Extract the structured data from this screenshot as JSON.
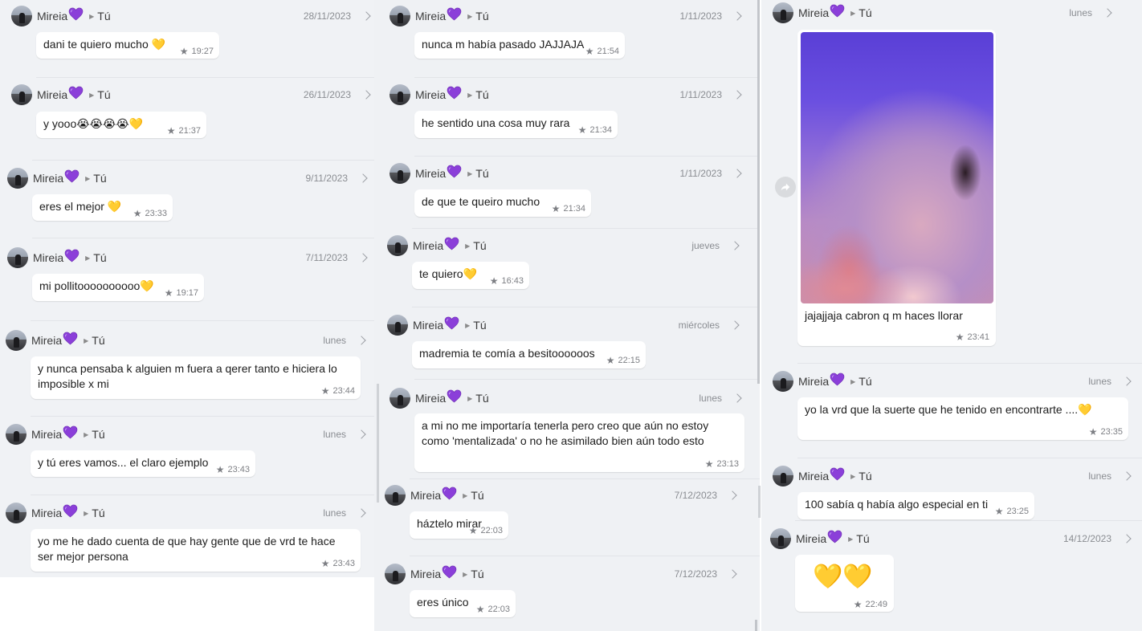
{
  "contact": {
    "name": "Mireia",
    "to": "Tú"
  },
  "columns": [
    {
      "entries": [
        {
          "date": "28/11/2023",
          "text": "dani te quiero mucho 💛",
          "time": "19:27"
        },
        {
          "date": "26/11/2023",
          "text": "y yooo😭😭😭😭💛",
          "time": "21:37"
        },
        {
          "date": "9/11/2023",
          "text": "eres el mejor 💛",
          "time": "23:33"
        },
        {
          "date": "7/11/2023",
          "text": "mi pollitoooooooooo💛",
          "time": "19:17"
        },
        {
          "date": "lunes",
          "text": "y nunca pensaba k alguien m fuera a qerer tanto e hiciera lo imposible x mi",
          "time": "23:44"
        },
        {
          "date": "lunes",
          "text": "y tú eres vamos... el claro ejemplo",
          "time": "23:43"
        },
        {
          "date": "lunes",
          "text": "yo me he dado cuenta de que hay gente que de vrd te hace ser mejor persona",
          "time": "23:43"
        }
      ]
    },
    {
      "entries": [
        {
          "date": "1/11/2023",
          "text": "nunca m había pasado JAJJAJA",
          "time": "21:54"
        },
        {
          "date": "1/11/2023",
          "text": "he sentido una cosa muy rara",
          "time": "21:34"
        },
        {
          "date": "1/11/2023",
          "text": "de que te queiro mucho",
          "time": "21:34"
        },
        {
          "date": "jueves",
          "text": "te quiero💛",
          "time": "16:43"
        },
        {
          "date": "miércoles",
          "text": "madremia te comía a besitoooooos",
          "time": "22:15"
        },
        {
          "date": "lunes",
          "text": "a mi no me importaría tenerla pero creo que aún no estoy como 'mentalizada' o no he asimilado bien aún todo esto",
          "time": "23:13"
        },
        {
          "date": "7/12/2023",
          "text": "háztelo mirar",
          "time": "22:03"
        },
        {
          "date": "7/12/2023",
          "text": "eres único",
          "time": "22:03"
        }
      ]
    },
    {
      "entries": [
        {
          "date": "lunes",
          "text": "jajajjaja cabron q m haces llorar",
          "time": "23:41",
          "has_photo": true
        },
        {
          "date": "lunes",
          "text": "yo la vrd que la suerte que he tenido en encontrarte ....💛",
          "time": "23:35"
        },
        {
          "date": "lunes",
          "text": "100 sabía q había algo especial en ti",
          "time": "23:25"
        },
        {
          "date": "14/12/2023",
          "text": "💛💛",
          "time": "22:49"
        }
      ]
    }
  ],
  "icons": {
    "star": "star-icon",
    "forward": "forward-icon",
    "heart": "purple-heart-emoji",
    "chevron": "chevron-right-icon"
  },
  "colors": {
    "background": "#f0f2f5",
    "bubble": "#ffffff",
    "heart": "#8b3fd9",
    "yellow_heart": "#f5c518"
  }
}
